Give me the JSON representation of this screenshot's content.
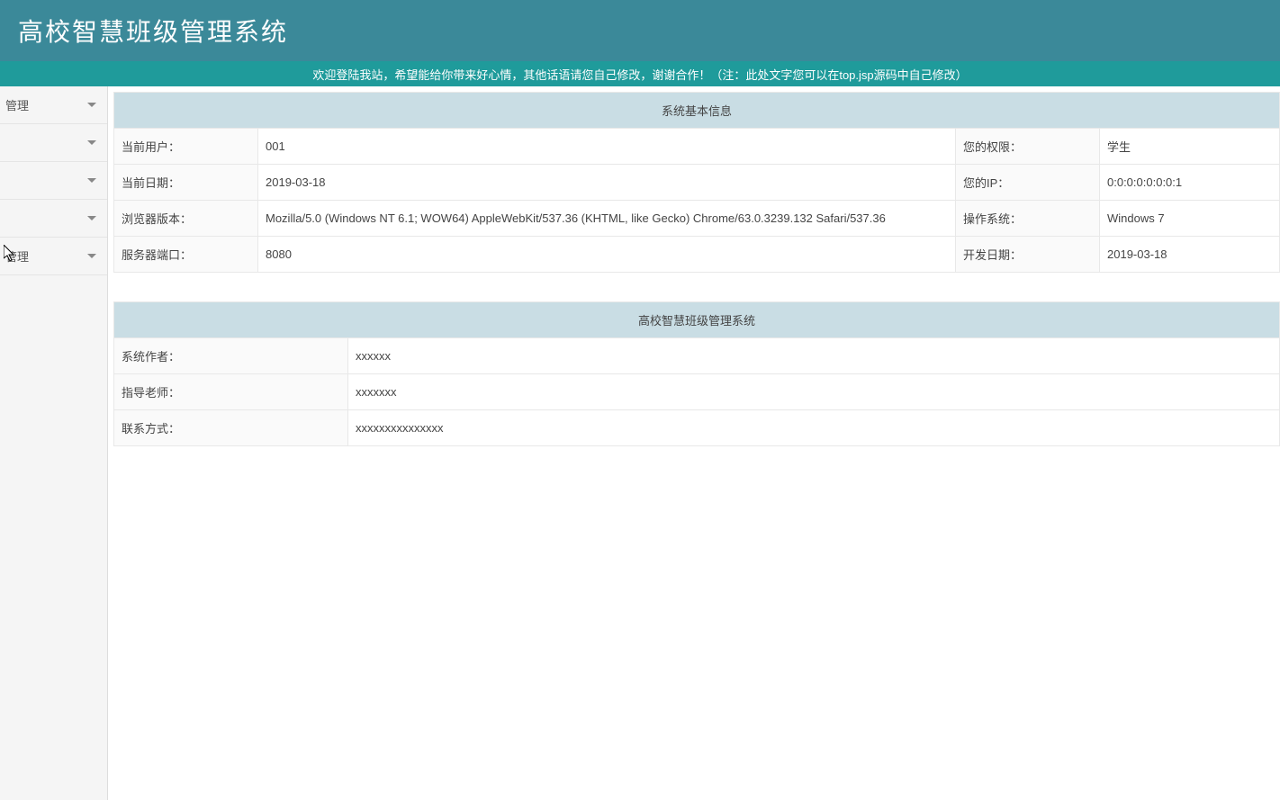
{
  "header": {
    "title": "高校智慧班级管理系统",
    "welcome": "欢迎登陆我站，希望能给你带来好心情，其他话语请您自己修改，谢谢合作！（注：此处文字您可以在top.jsp源码中自己修改）"
  },
  "sidebar": {
    "items": [
      {
        "label": "管理"
      },
      {
        "label": ""
      },
      {
        "label": ""
      },
      {
        "label": ""
      },
      {
        "label": "管理"
      }
    ]
  },
  "system_info": {
    "header": "系统基本信息",
    "rows": [
      {
        "label1": "当前用户：",
        "value1": "001",
        "label2": "您的权限：",
        "value2": "学生"
      },
      {
        "label1": "当前日期：",
        "value1": "2019-03-18",
        "label2": "您的IP：",
        "value2": "0:0:0:0:0:0:0:1"
      },
      {
        "label1": "浏览器版本：",
        "value1": "Mozilla/5.0 (Windows NT 6.1; WOW64) AppleWebKit/537.36 (KHTML, like Gecko) Chrome/63.0.3239.132 Safari/537.36",
        "label2": "操作系统：",
        "value2": "Windows 7"
      },
      {
        "label1": "服务器端口：",
        "value1": "8080",
        "label2": "开发日期：",
        "value2": "2019-03-18"
      }
    ]
  },
  "project_info": {
    "header": "高校智慧班级管理系统",
    "rows": [
      {
        "label": "系统作者：",
        "value": "xxxxxx"
      },
      {
        "label": "指导老师：",
        "value": "xxxxxxx"
      },
      {
        "label": "联系方式：",
        "value": "xxxxxxxxxxxxxxx"
      }
    ]
  }
}
